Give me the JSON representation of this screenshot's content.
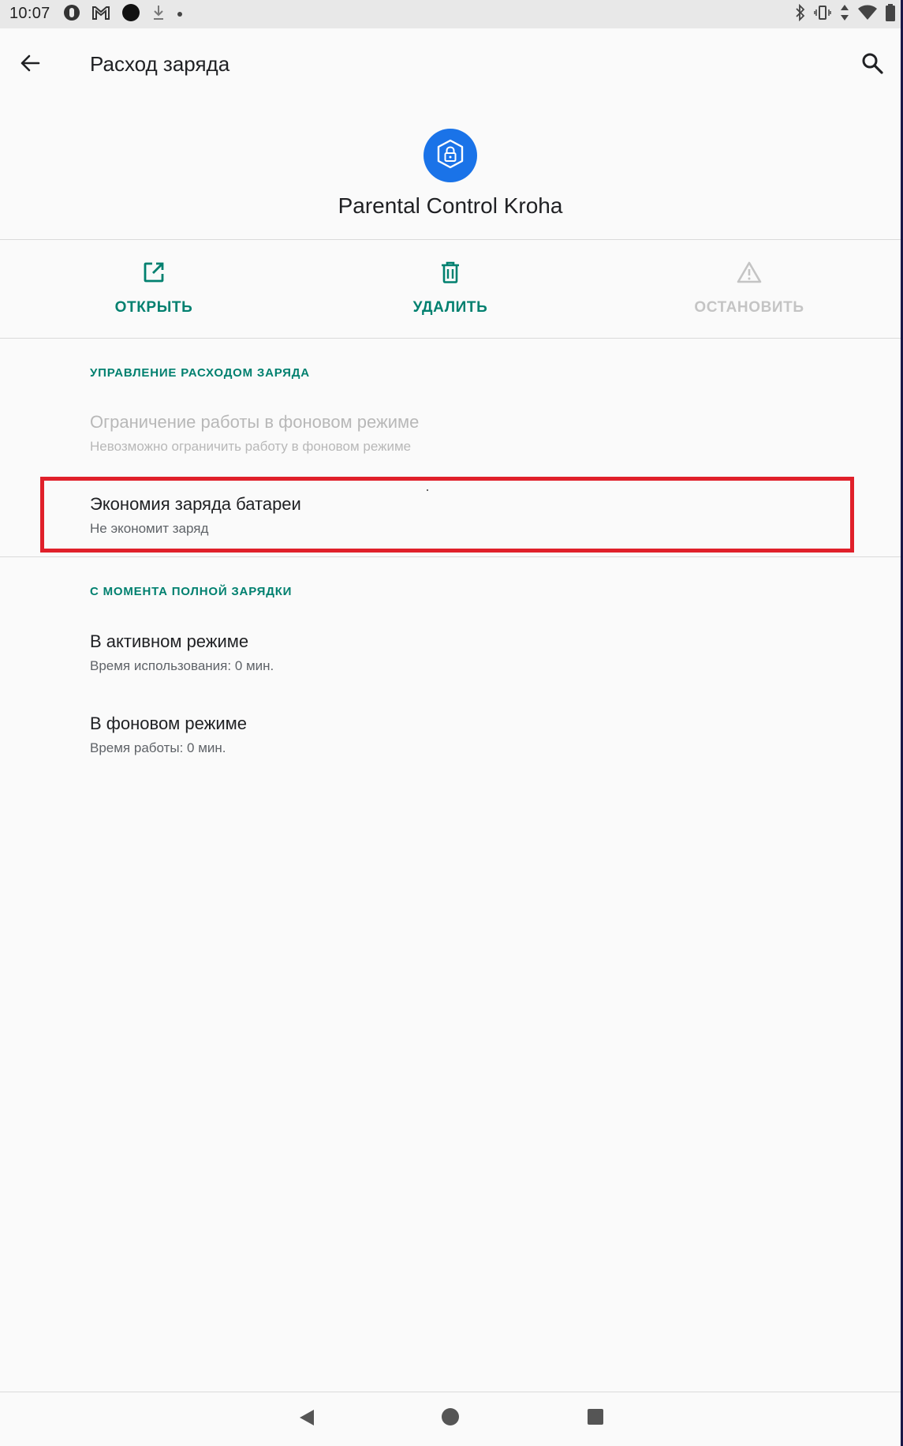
{
  "status_bar": {
    "time": "10:07",
    "left_icons": [
      "alarm-icon",
      "gmail-icon",
      "record-icon",
      "download-icon",
      "dot-icon"
    ],
    "right_icons": [
      "bluetooth-icon",
      "vibrate-icon",
      "data-arrows-icon",
      "wifi-icon",
      "battery-icon"
    ]
  },
  "app_bar": {
    "title": "Расход заряда",
    "back_icon": "arrow-back-icon",
    "search_icon": "search-icon"
  },
  "app_header": {
    "name": "Parental Control Kroha",
    "icon": "shield-lock-icon",
    "icon_color": "#1a73e8"
  },
  "actions": [
    {
      "label": "ОТКРЫТЬ",
      "icon": "open-in-new-icon",
      "enabled": true
    },
    {
      "label": "УДАЛИТЬ",
      "icon": "trash-icon",
      "enabled": true
    },
    {
      "label": "ОСТАНОВИТЬ",
      "icon": "warning-icon",
      "enabled": false
    }
  ],
  "sections": {
    "battery_management": {
      "header": "УПРАВЛЕНИЕ РАСХОДОМ ЗАРЯДА",
      "items": [
        {
          "title": "Ограничение работы в фоновом режиме",
          "summary": "Невозможно ограничить работу в фоновом режиме",
          "enabled": false
        },
        {
          "title": "Экономия заряда батареи",
          "summary": "Не экономит заряд",
          "enabled": true
        }
      ]
    },
    "since_full_charge": {
      "header": "С МОМЕНТА ПОЛНОЙ ЗАРЯДКИ",
      "items": [
        {
          "title": "В активном режиме",
          "summary": "Время использования: 0 мин."
        },
        {
          "title": "В фоновом режиме",
          "summary": "Время работы: 0 мин."
        }
      ]
    }
  },
  "colors": {
    "accent": "#00806f",
    "highlight": "#e0202a",
    "background": "#fafafa"
  },
  "nav_bar": {
    "icons": [
      "nav-back-icon",
      "nav-home-icon",
      "nav-recents-icon"
    ]
  }
}
